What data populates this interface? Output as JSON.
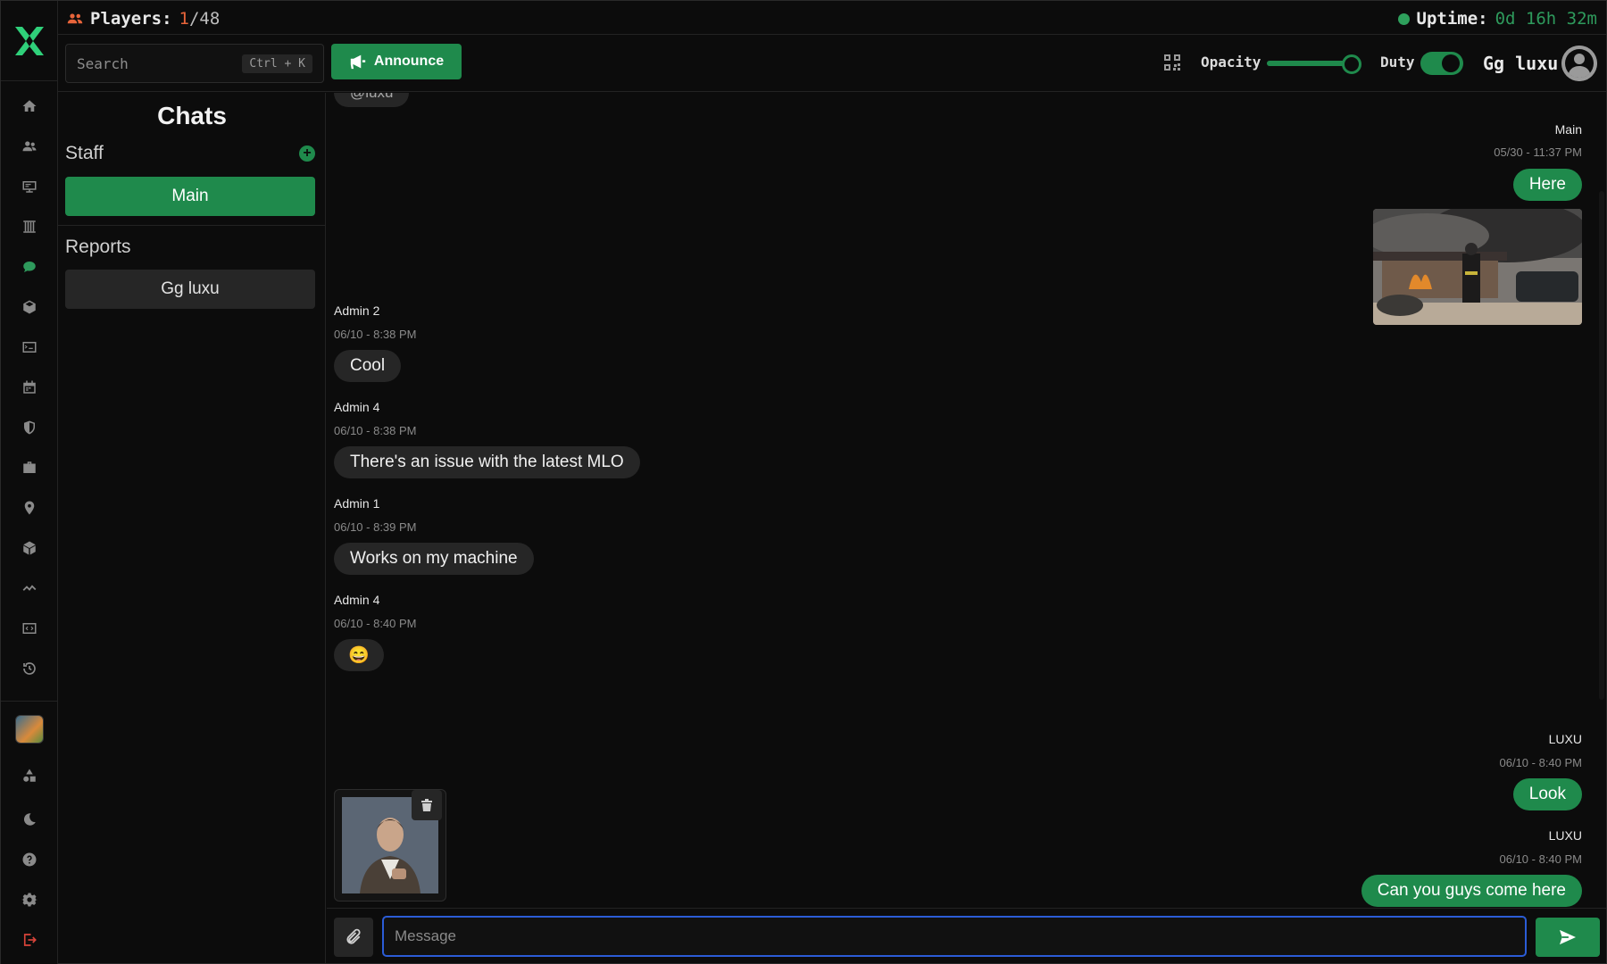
{
  "topbar": {
    "players_label": "Players:",
    "players_current": "1",
    "players_max": "/48",
    "uptime_label": "Uptime:",
    "uptime_value": "0d 16h 32m"
  },
  "toolbar": {
    "search_placeholder": "Search",
    "search_shortcut": "Ctrl + K",
    "announce_label": "Announce",
    "opacity_label": "Opacity",
    "opacity_value": 0.9,
    "duty_label": "Duty",
    "duty_on": true,
    "username": "Gg luxu"
  },
  "chats": {
    "title": "Chats",
    "staff_title": "Staff",
    "staff_channels": [
      "Main"
    ],
    "reports_title": "Reports",
    "report_channels": [
      "Gg luxu"
    ]
  },
  "messages": {
    "top_partial": "@luxu",
    "m1": {
      "author": "Main",
      "time": "05/30 - 11:37 PM",
      "text": "Here"
    },
    "m2": {
      "author": "Admin 2",
      "time": "06/10 - 8:38 PM",
      "text": "Cool"
    },
    "m3": {
      "author": "Admin 4",
      "time": "06/10 - 8:38 PM",
      "text": "There's an issue with the latest MLO"
    },
    "m4": {
      "author": "Admin 1",
      "time": "06/10 - 8:39 PM",
      "text": "Works on my machine"
    },
    "m5": {
      "author": "Admin 4",
      "time": "06/10 - 8:40 PM",
      "text": "😄"
    },
    "m6": {
      "author": "LUXU",
      "time": "06/10 - 8:40 PM",
      "text": "Look"
    },
    "m7": {
      "author": "LUXU",
      "time": "06/10 - 8:40 PM",
      "text": "Can you guys come here"
    }
  },
  "composer": {
    "placeholder": "Message"
  },
  "colors": {
    "accent": "#1f8a4c",
    "players_current": "#e8643a",
    "uptime": "#2e9a5c",
    "input_focus": "#2b5cd6"
  }
}
